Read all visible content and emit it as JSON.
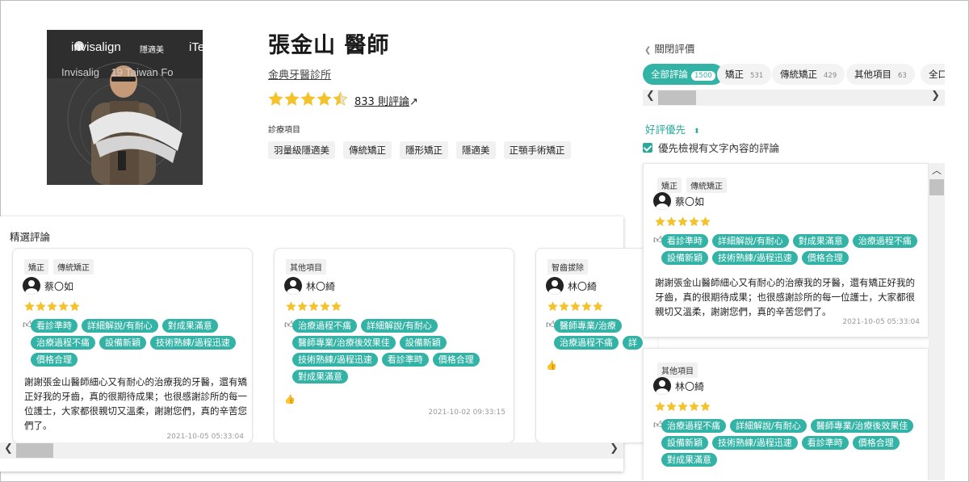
{
  "doctor": {
    "name": "張金山 醫師",
    "clinic": "金典牙醫診所",
    "review_count": "833 則評論",
    "review_arrow": "↗",
    "treatment_label": "診療項目",
    "treatments": [
      "羽量級隱適美",
      "傳統矯正",
      "隱形矯正",
      "隱適美",
      "正顎手術矯正"
    ]
  },
  "photo": {
    "banner_left": "invisalign",
    "banner_cn": "隱適美",
    "banner_right": "iTe",
    "subtitle": "Invisalig    19 Taiwan Fo"
  },
  "featured": {
    "title": "精選評論",
    "cards": [
      {
        "tags": [
          "矯正",
          "傳統矯正"
        ],
        "user": "蔡〇如",
        "praise": [
          "看診準時",
          "詳細解說/有耐心",
          "對成果滿意",
          "治療過程不痛",
          "設備新穎",
          "技術熟練/過程迅速",
          "價格合理"
        ],
        "text": "謝謝張金山醫師細心又有耐心的治療我的牙醫，還有矯正好我的牙齒，真的很期待成果；也很感謝診所的每一位護士，大家都很親切又溫柔，謝謝您們，真的辛苦您們了。",
        "date": "2021-10-05 05:33:04"
      },
      {
        "tags": [
          "其他項目"
        ],
        "user": "林〇綺",
        "praise": [
          "治療過程不痛",
          "詳細解說/有耐心",
          "醫師專業/治療後效果佳",
          "設備新穎",
          "技術熟練/過程迅速",
          "看診準時",
          "價格合理",
          "對成果滿意"
        ],
        "text": "",
        "date": "2021-10-02 09:33:15"
      },
      {
        "tags": [
          "智齒拔除"
        ],
        "user": "林〇綺",
        "praise": [
          "醫師專業/治療",
          "治療過程不痛",
          "詳"
        ],
        "text": "",
        "date": ""
      }
    ]
  },
  "right_panel": {
    "close": "關閉評價",
    "tabs": [
      {
        "label": "全部評論",
        "count": "1500"
      },
      {
        "label": "矯正",
        "count": "531"
      },
      {
        "label": "傳統矯正",
        "count": "429"
      },
      {
        "label": "其他項目",
        "count": "63"
      },
      {
        "label": "全口",
        "count": ""
      }
    ],
    "sort": "好評優先",
    "sort_icon": "⬍",
    "text_only": "優先檢視有文字內容的評論",
    "reviews": [
      {
        "tags": [
          "矯正",
          "傳統矯正"
        ],
        "user": "蔡〇如",
        "praise": [
          "看診準時",
          "詳細解說/有耐心",
          "對成果滿意",
          "治療過程不痛",
          "設備新穎",
          "技術熟練/過程迅速",
          "價格合理"
        ],
        "text": "謝謝張金山醫師細心又有耐心的治療我的牙醫，還有矯正好我的牙齒，真的很期待成果；也很感謝診所的每一位護士，大家都很親切又溫柔，謝謝您們，真的辛苦您們了。",
        "date": "2021-10-05 05:33:04"
      },
      {
        "tags": [
          "其他項目"
        ],
        "user": "林〇綺",
        "praise": [
          "治療過程不痛",
          "詳細解說/有耐心",
          "醫師專業/治療後效果佳",
          "設備新穎",
          "技術熟練/過程迅速",
          "看診準時",
          "價格合理",
          "對成果滿意"
        ],
        "text": "",
        "date": ""
      }
    ]
  },
  "rating": {
    "value": 4.5,
    "max": 5,
    "star_color": "#f4c22b"
  },
  "colors": {
    "accent": "#33b3a6",
    "thumb_up": "#d9a600"
  }
}
